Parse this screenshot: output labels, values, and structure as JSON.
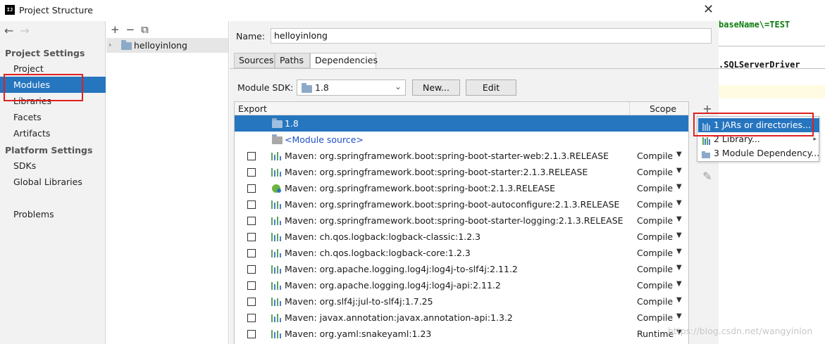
{
  "window": {
    "title": "Project Structure",
    "close_glyph": "✕"
  },
  "editor_bg": {
    "line1": "baseName\\=TEST",
    "line2": ".SQLServerDriver",
    "watermark": "https://blog.csdn.net/wangyinlon"
  },
  "nav": {
    "back": "←",
    "forward": "→",
    "project_settings": "Project Settings",
    "project": "Project",
    "modules": "Modules",
    "libraries": "Libraries",
    "facets": "Facets",
    "artifacts": "Artifacts",
    "platform_settings": "Platform Settings",
    "sdks": "SDKs",
    "global_libraries": "Global Libraries",
    "problems": "Problems"
  },
  "tree": {
    "add": "+",
    "remove": "−",
    "copy": "⧉",
    "expand": "›",
    "module_name": "helloyinlong"
  },
  "module": {
    "name_label": "Name:",
    "name_value": "helloyinlong",
    "tabs": [
      "Sources",
      "Paths",
      "Dependencies"
    ],
    "sdk_label": "Module SDK:",
    "sdk_value": "1.8",
    "new_button": "New...",
    "edit_button": "Edit"
  },
  "deps": {
    "header_export": "Export",
    "header_scope": "Scope",
    "sdk_row": "1.8",
    "module_source": "<Module source>",
    "rows": [
      {
        "name": "Maven: org.springframework.boot:spring-boot-starter-web:2.1.3.RELEASE",
        "scope": "Compile"
      },
      {
        "name": "Maven: org.springframework.boot:spring-boot-starter:2.1.3.RELEASE",
        "scope": "Compile"
      },
      {
        "name": "Maven: org.springframework.boot:spring-boot:2.1.3.RELEASE",
        "scope": "Compile"
      },
      {
        "name": "Maven: org.springframework.boot:spring-boot-autoconfigure:2.1.3.RELEASE",
        "scope": "Compile"
      },
      {
        "name": "Maven: org.springframework.boot:spring-boot-starter-logging:2.1.3.RELEASE",
        "scope": "Compile"
      },
      {
        "name": "Maven: ch.qos.logback:logback-classic:1.2.3",
        "scope": "Compile"
      },
      {
        "name": "Maven: ch.qos.logback:logback-core:1.2.3",
        "scope": "Compile"
      },
      {
        "name": "Maven: org.apache.logging.log4j:log4j-to-slf4j:2.11.2",
        "scope": "Compile"
      },
      {
        "name": "Maven: org.apache.logging.log4j:log4j-api:2.11.2",
        "scope": "Compile"
      },
      {
        "name": "Maven: org.slf4j:jul-to-slf4j:1.7.25",
        "scope": "Compile"
      },
      {
        "name": "Maven: javax.annotation:javax.annotation-api:1.3.2",
        "scope": "Compile"
      },
      {
        "name": "Maven: org.yaml:snakeyaml:1.23",
        "scope": "Runtime"
      }
    ]
  },
  "side_tools": {
    "add": "+",
    "edit": "✎"
  },
  "popup": {
    "items": [
      {
        "label": "1  JARs or directories..."
      },
      {
        "label": "2  Library..."
      },
      {
        "label": "3  Module Dependency..."
      }
    ],
    "submenu_arrow": "▸"
  }
}
